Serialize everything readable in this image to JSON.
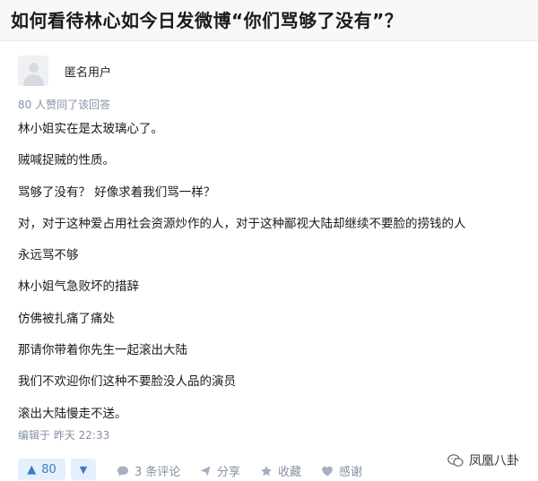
{
  "question": {
    "title": "如何看待林心如今日发微博“你们骂够了没有”？"
  },
  "answer": {
    "author_name": "匿名用户",
    "upvote_summary": "80 人赞同了该回答",
    "paragraphs": [
      "林小姐实在是太玻璃心了。",
      "贼喊捉贼的性质。",
      "骂够了没有？ 好像求着我们骂一样？",
      "对，对于这种爱占用社会资源炒作的人，对于这种鄙视大陆却继续不要脸的捞钱的人",
      "永远骂不够",
      "林小姐气急败坏的措辞",
      "仿佛被扎痛了痛处",
      "那请你带着你先生一起滚出大陆",
      "我们不欢迎你们这种不要脸没人品的演员",
      "滚出大陆慢走不送。"
    ],
    "edited_label": "编辑于 昨天 22:33"
  },
  "actions": {
    "upvote_count": "80",
    "comments_label": "3 条评论",
    "share_label": "分享",
    "collect_label": "收藏",
    "thanks_label": "感谢"
  },
  "watermark": {
    "text": "凤凰八卦"
  },
  "colors": {
    "accent": "#3e7ac2",
    "vote_bg": "#e5f0ff",
    "meta_text": "#8590a6",
    "title_bar_bg": "#f7f8fa"
  }
}
